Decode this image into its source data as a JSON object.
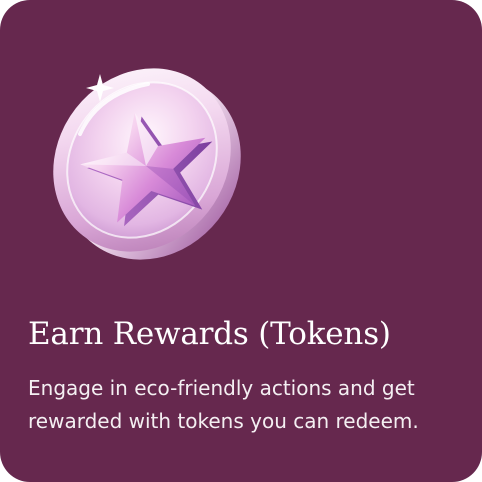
{
  "card": {
    "background_color": "#66284e",
    "icon": "star-coin-icon",
    "title": "Earn Rewards (Tokens)",
    "description": "Engage in eco-friendly actions and get rewarded with tokens you can redeem."
  }
}
